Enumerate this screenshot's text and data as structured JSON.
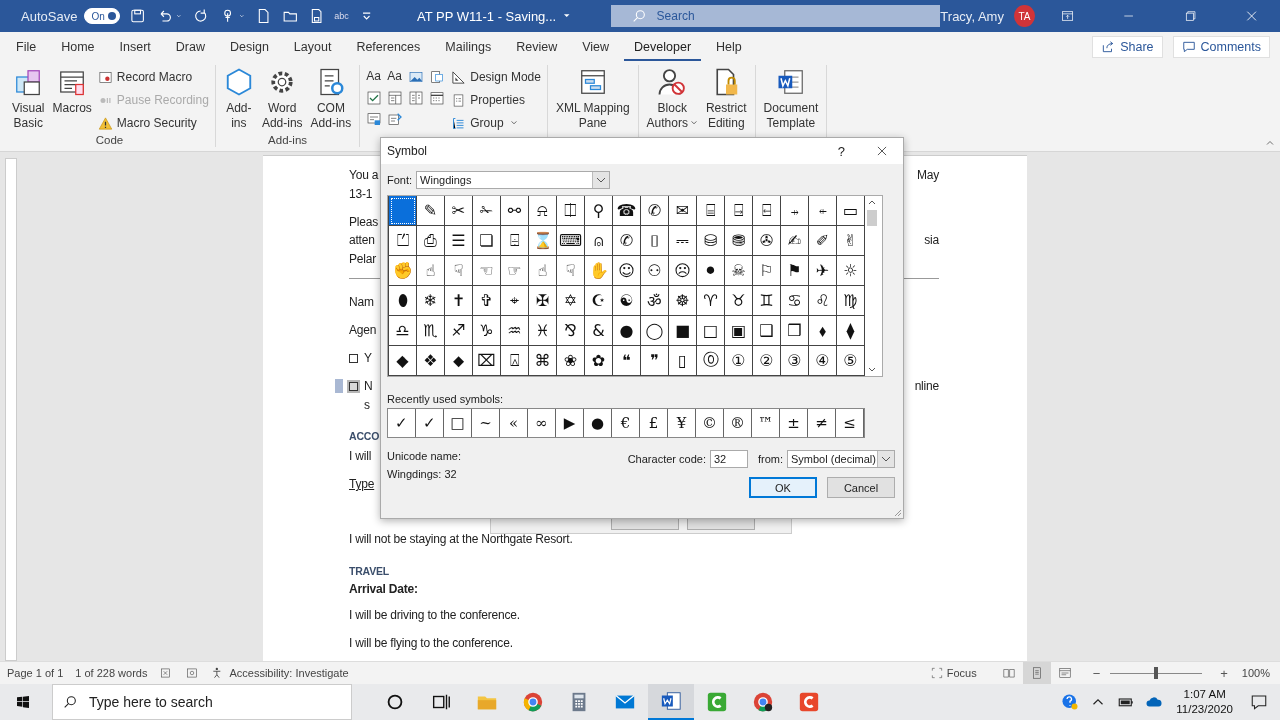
{
  "title_bar": {
    "autosave_label": "AutoSave",
    "autosave": {
      "on": true,
      "label": "On"
    },
    "quick_access": [
      {
        "kind": "save"
      },
      {
        "kind": "undo"
      },
      {
        "kind": "caret"
      },
      {
        "kind": "redo"
      },
      {
        "kind": "touch"
      },
      {
        "kind": "caret"
      },
      {
        "kind": "new"
      },
      {
        "kind": "open"
      },
      {
        "kind": "print"
      },
      {
        "kind": "spelling",
        "text": "abc"
      },
      {
        "kind": "customize"
      }
    ],
    "document_title": "AT PP W11-1  -  Saving...",
    "search": {
      "placeholder": "Search"
    },
    "user_name": "Tracy, Amy",
    "avatar_initials": "TA"
  },
  "ribbon_tabs": [
    {
      "label": "File",
      "selected": false
    },
    {
      "label": "Home",
      "selected": false
    },
    {
      "label": "Insert",
      "selected": false
    },
    {
      "label": "Draw",
      "selected": false
    },
    {
      "label": "Design",
      "selected": false
    },
    {
      "label": "Layout",
      "selected": false
    },
    {
      "label": "References",
      "selected": false
    },
    {
      "label": "Mailings",
      "selected": false
    },
    {
      "label": "Review",
      "selected": false
    },
    {
      "label": "View",
      "selected": false
    },
    {
      "label": "Developer",
      "selected": true
    },
    {
      "label": "Help",
      "selected": false
    }
  ],
  "share_label": "Share",
  "comments_label": "Comments",
  "ribbon_groups": [
    {
      "label": "Code",
      "large": [
        {
          "lines": [
            "Visual",
            "Basic"
          ],
          "kind": "vb"
        },
        {
          "lines": [
            "Macros"
          ],
          "kind": "macros"
        }
      ],
      "small": [
        {
          "label": "Record Macro",
          "kind": "record",
          "disabled": false
        },
        {
          "label": "Pause Recording",
          "kind": "pause",
          "disabled": true
        },
        {
          "label": "Macro Security",
          "kind": "warning",
          "disabled": false
        }
      ]
    },
    {
      "label": "Add-ins",
      "large": [
        {
          "lines": [
            "Add-",
            "ins"
          ],
          "kind": "addins"
        },
        {
          "lines": [
            "Word",
            "Add-ins"
          ],
          "kind": "gear"
        },
        {
          "lines": [
            "COM",
            "Add-ins"
          ],
          "kind": "com"
        }
      ]
    },
    {
      "controls": [
        {
          "kind": "aa",
          "text": "Aa"
        },
        {
          "kind": "aa",
          "text": "Aa"
        },
        {
          "kind": "image"
        },
        {
          "kind": "block"
        },
        {
          "kind": "checkbox"
        },
        {
          "kind": "combo"
        },
        {
          "kind": "list"
        },
        {
          "kind": "date"
        },
        {
          "kind": "legacy"
        },
        {
          "kind": "tools"
        }
      ],
      "small": [
        {
          "label": "Design Mode",
          "kind": "design",
          "disabled": false
        },
        {
          "label": "Properties",
          "kind": "props",
          "disabled": false
        },
        {
          "label": "Group",
          "kind": "group",
          "disabled": false,
          "dropdown": true
        }
      ]
    },
    {
      "large": [
        {
          "lines": [
            "XML Mapping",
            "Pane"
          ],
          "kind": "xml"
        }
      ]
    },
    {
      "large": [
        {
          "lines": [
            "Block",
            "Authors"
          ],
          "kind": "block-authors",
          "dropdown": true
        },
        {
          "lines": [
            "Restrict",
            "Editing"
          ],
          "kind": "restrict"
        }
      ]
    },
    {
      "large": [
        {
          "lines": [
            "Document",
            "Template"
          ],
          "kind": "template"
        }
      ]
    }
  ],
  "document": {
    "blocks": [
      {
        "kind": "para",
        "lines": [
          {
            "left": "You a",
            "right": "May"
          },
          {
            "left": "13-1"
          }
        ]
      },
      {
        "kind": "para",
        "lines": [
          {
            "left": "Pleas"
          },
          {
            "left": "atten",
            "right": "sia"
          },
          {
            "left": "Pelar"
          }
        ]
      },
      {
        "kind": "rule"
      },
      {
        "kind": "para",
        "lines": [
          {
            "left": "Nam"
          }
        ]
      },
      {
        "kind": "para",
        "lines": [
          {
            "left": "Agen"
          }
        ]
      },
      {
        "kind": "checkbox",
        "checked": false,
        "selected": false,
        "lines": [
          {
            "left": "Y"
          }
        ]
      },
      {
        "kind": "checkbox",
        "checked": false,
        "selected": true,
        "lines": [
          {
            "left": "N",
            "right": "nline"
          },
          {
            "left": "s"
          }
        ]
      },
      {
        "kind": "heading",
        "text": "ACCO"
      },
      {
        "kind": "para",
        "lines": [
          {
            "left": "I will"
          }
        ]
      },
      {
        "kind": "field_label",
        "text": "Type"
      },
      {
        "kind": "para",
        "lines": [
          {
            "left": "I will not be staying at the Northgate Resort."
          }
        ]
      },
      {
        "kind": "heading",
        "text": "TRAVEL"
      },
      {
        "kind": "bold",
        "text": "Arrival Date:"
      },
      {
        "kind": "para",
        "lines": [
          {
            "left": "I will be driving to the conference."
          }
        ]
      },
      {
        "kind": "para",
        "lines": [
          {
            "left": "I will be flying to the conference."
          }
        ]
      }
    ]
  },
  "symbol_dialog": {
    "title": "Symbol",
    "help": "?",
    "font_label": "Font:",
    "font_value": "Wingdings",
    "grid": [
      [
        {
          "selected": true
        },
        {
          "glyph": "✎",
          "selected": false
        },
        {
          "glyph": "✂",
          "selected": false
        },
        {
          "glyph": "✁",
          "selected": false
        },
        {
          "glyph": "⚯",
          "selected": false
        },
        {
          "glyph": "⍾",
          "selected": false
        },
        {
          "glyph": "⎅",
          "selected": false
        },
        {
          "glyph": "⚲",
          "selected": false
        },
        {
          "glyph": "☎",
          "selected": false
        },
        {
          "glyph": "✆",
          "selected": false
        },
        {
          "glyph": "✉",
          "selected": false
        },
        {
          "glyph": "⌸",
          "selected": false
        },
        {
          "glyph": "⍈",
          "selected": false
        },
        {
          "glyph": "⍇",
          "selected": false
        },
        {
          "glyph": "⍆",
          "selected": false
        },
        {
          "glyph": "⍅",
          "selected": false
        },
        {
          "glyph": "▭",
          "selected": false
        }
      ],
      [
        {
          "glyph": "⏍",
          "selected": false
        },
        {
          "glyph": "⎙",
          "selected": false
        },
        {
          "glyph": "☰",
          "selected": false
        },
        {
          "glyph": "❏",
          "selected": false
        },
        {
          "glyph": "⌹",
          "selected": false
        },
        {
          "glyph": "⌛",
          "selected": false
        },
        {
          "glyph": "⌨",
          "selected": false
        },
        {
          "glyph": "⍝",
          "selected": false
        },
        {
          "glyph": "✆",
          "selected": false
        },
        {
          "glyph": "⌷",
          "selected": false
        },
        {
          "glyph": "⎓",
          "selected": false
        },
        {
          "glyph": "⛁",
          "selected": false
        },
        {
          "glyph": "⛃",
          "selected": false
        },
        {
          "glyph": "✇",
          "selected": false
        },
        {
          "glyph": "✍",
          "selected": false
        },
        {
          "glyph": "✐",
          "selected": false
        },
        {
          "glyph": "✌",
          "selected": false
        }
      ],
      [
        {
          "glyph": "✊",
          "selected": false
        },
        {
          "glyph": "☝",
          "selected": false
        },
        {
          "glyph": "☟",
          "selected": false
        },
        {
          "glyph": "☜",
          "selected": false
        },
        {
          "glyph": "☞",
          "selected": false
        },
        {
          "glyph": "☝",
          "selected": false
        },
        {
          "glyph": "☟",
          "selected": false
        },
        {
          "glyph": "✋",
          "selected": false
        },
        {
          "glyph": "☺",
          "selected": false
        },
        {
          "glyph": "⚇",
          "selected": false
        },
        {
          "glyph": "☹",
          "selected": false
        },
        {
          "glyph": "⚫",
          "selected": false
        },
        {
          "glyph": "☠",
          "selected": false
        },
        {
          "glyph": "⚐",
          "selected": false
        },
        {
          "glyph": "⚑",
          "selected": false
        },
        {
          "glyph": "✈",
          "selected": false
        },
        {
          "glyph": "☼",
          "selected": false
        }
      ],
      [
        {
          "glyph": "⬮",
          "selected": false
        },
        {
          "glyph": "❄",
          "selected": false
        },
        {
          "glyph": "✝",
          "selected": false
        },
        {
          "glyph": "✞",
          "selected": false
        },
        {
          "glyph": "⌖",
          "selected": false
        },
        {
          "glyph": "✠",
          "selected": false
        },
        {
          "glyph": "✡",
          "selected": false
        },
        {
          "glyph": "☪",
          "selected": false
        },
        {
          "glyph": "☯",
          "selected": false
        },
        {
          "glyph": "ॐ",
          "selected": false
        },
        {
          "glyph": "☸",
          "selected": false
        },
        {
          "glyph": "♈",
          "selected": false
        },
        {
          "glyph": "♉",
          "selected": false
        },
        {
          "glyph": "♊",
          "selected": false
        },
        {
          "glyph": "♋",
          "selected": false
        },
        {
          "glyph": "♌",
          "selected": false
        },
        {
          "glyph": "♍",
          "selected": false
        }
      ],
      [
        {
          "glyph": "♎",
          "selected": false
        },
        {
          "glyph": "♏",
          "selected": false
        },
        {
          "glyph": "♐",
          "selected": false
        },
        {
          "glyph": "♑",
          "selected": false
        },
        {
          "glyph": "♒",
          "selected": false
        },
        {
          "glyph": "♓",
          "selected": false
        },
        {
          "glyph": "⅋",
          "selected": false
        },
        {
          "glyph": "&",
          "selected": false
        },
        {
          "glyph": "●",
          "selected": false
        },
        {
          "glyph": "◯",
          "selected": false
        },
        {
          "glyph": "■",
          "selected": false
        },
        {
          "glyph": "□",
          "selected": false
        },
        {
          "glyph": "▣",
          "selected": false
        },
        {
          "glyph": "❑",
          "selected": false
        },
        {
          "glyph": "❒",
          "selected": false
        },
        {
          "glyph": "⬧",
          "selected": false
        },
        {
          "glyph": "⧫",
          "selected": false
        }
      ],
      [
        {
          "glyph": "◆",
          "selected": false
        },
        {
          "glyph": "❖",
          "selected": false
        },
        {
          "glyph": "⬥",
          "selected": false
        },
        {
          "glyph": "⌧",
          "selected": false
        },
        {
          "glyph": "⍓",
          "selected": false
        },
        {
          "glyph": "⌘",
          "selected": false
        },
        {
          "glyph": "❀",
          "selected": false
        },
        {
          "glyph": "✿",
          "selected": false
        },
        {
          "glyph": "❝",
          "selected": false
        },
        {
          "glyph": "❞",
          "selected": false
        },
        {
          "glyph": "▯",
          "selected": false
        },
        {
          "glyph": "⓪",
          "selected": false
        },
        {
          "glyph": "①",
          "selected": false
        },
        {
          "glyph": "②",
          "selected": false
        },
        {
          "glyph": "③",
          "selected": false
        },
        {
          "glyph": "④",
          "selected": false
        },
        {
          "glyph": "⑤",
          "selected": false
        }
      ]
    ],
    "recent_label": "Recently used symbols:",
    "recent": [
      "✓",
      "✓",
      "□",
      "~",
      "«",
      "∞",
      "▶",
      "●",
      "€",
      "£",
      "¥",
      "©",
      "®",
      "™",
      "±",
      "≠",
      "≤"
    ],
    "unicode_name_label": "Unicode name:",
    "unicode_name": "Wingdings: 32",
    "char_code_label": "Character code:",
    "char_code": "32",
    "from_label": "from:",
    "from_value": "Symbol (decimal)",
    "buttons": [
      {
        "label": "OK",
        "default": true
      },
      {
        "label": "Cancel",
        "default": false
      }
    ]
  },
  "status_bar": {
    "page": "Page 1 of 1",
    "words": "1 of 228 words",
    "accessibility": "Accessibility: Investigate",
    "focus": "Focus",
    "views": [
      {
        "kind": "read",
        "selected": false
      },
      {
        "kind": "print",
        "selected": true
      },
      {
        "kind": "web",
        "selected": false
      }
    ],
    "zoom_minus": "−",
    "zoom_plus": "+",
    "zoom": {
      "level": 0.5
    },
    "zoom_reading": "100%"
  },
  "taskbar": {
    "search_placeholder": "Type here to search",
    "apps": [
      {
        "kind": "cortana"
      },
      {
        "kind": "taskview"
      },
      {
        "kind": "folder"
      },
      {
        "kind": "browser"
      },
      {
        "kind": "calculator"
      },
      {
        "kind": "mail"
      },
      {
        "kind": "word"
      },
      {
        "kind": "green"
      },
      {
        "kind": "browser2"
      },
      {
        "kind": "red"
      }
    ],
    "time": "1:07 AM",
    "date": "11/23/2020"
  }
}
